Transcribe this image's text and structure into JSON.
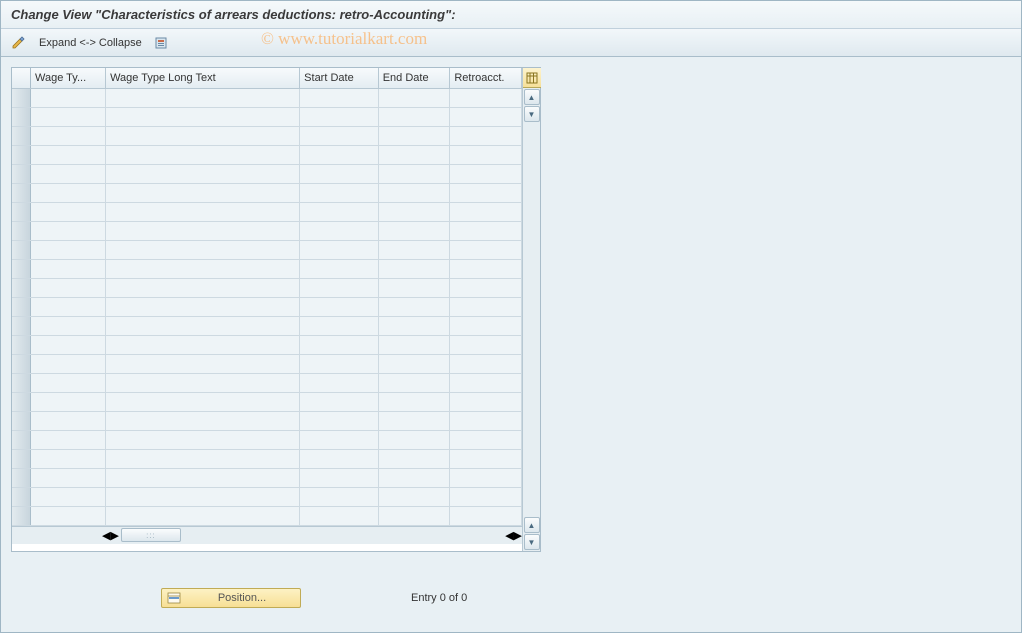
{
  "header": {
    "title": "Change View \"Characteristics of arrears deductions: retro-Accounting\":"
  },
  "toolbar": {
    "expand_collapse_label": "Expand <-> Collapse"
  },
  "watermark": "© www.tutorialkart.com",
  "table": {
    "columns": {
      "wage_type": "Wage Ty...",
      "long_text": "Wage Type Long Text",
      "start_date": "Start Date",
      "end_date": "End Date",
      "retroacct": "Retroacct."
    },
    "row_count": 23
  },
  "footer": {
    "position_label": "Position...",
    "entry_label": "Entry 0 of 0"
  }
}
